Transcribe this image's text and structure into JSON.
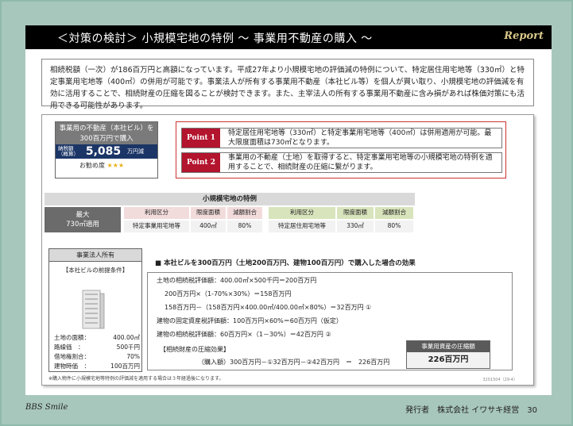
{
  "header": {
    "title": "＜対策の検討＞ 小規模宅地の特例 〜 事業用不動産の購入 〜",
    "badge": "Report"
  },
  "intro": "相続税額（一次）が186百万円と高額になっています。平成27年より小規模宅地の評価減の特例について、特定居住用宅地等（330㎡）と特定事業用宅地等（400㎡）の併用が可能です。事業法人が所有する事業用不動産（本社ビル等）を個人が買い取り、小規模宅地の評価減を有効に活用することで、相続財産の圧縮を図ることが検討できます。また、主宰法人の所有する事業用不動産に含み損があれば株価対策にも活用できる可能性があります。",
  "case": {
    "title": "事業用の不動産（本社ビル）を300百万円で購入",
    "amount_label": "納税額（概算）",
    "amount": "5,085",
    "unit": "万円減",
    "recommend_label": "お勧め度",
    "stars": "★★★"
  },
  "points": [
    {
      "tag": "Point 1",
      "text": "特定居住用宅地等（330㎡）と特定事業用宅地等（400㎡）は併用適用が可能。最大限度面積は730㎡となります。"
    },
    {
      "tag": "Point 2",
      "text": "事業用の不動産（土地）を取得すると、特定事業用宅地等の小規模宅地の特例を適用することで、相続財産の圧縮に繋がります。"
    }
  ],
  "table": {
    "caption": "小規模宅地の特例",
    "max_label": "最大",
    "max_value": "730㎡適用",
    "headers": [
      "利用区分",
      "限度面積",
      "減額割合",
      "利用区分",
      "限度面積",
      "減額割合"
    ],
    "row": [
      "特定事業用宅地等",
      "400㎡",
      "80%",
      "特定居住用宅地等",
      "330㎡",
      "80%"
    ]
  },
  "company": {
    "title": "事業法人所有",
    "condition": "【本社ビルの前提条件】",
    "facts": [
      {
        "k": "土地の面積：",
        "v": "400.00㎡"
      },
      {
        "k": "路線価　：",
        "v": "500千円"
      },
      {
        "k": "借地権割合：",
        "v": "70%"
      },
      {
        "k": "建物時価　：",
        "v": "100百万円"
      }
    ]
  },
  "calc": {
    "heading": "■ 本社ビルを300百万円（土地200百万円、建物100百万円）で購入した場合の効果",
    "lines": [
      "土地の相続税評価額：400.00㎡×500千円＝200百万円",
      "200百万円×（1-70%×30%）＝158百万円",
      "158百万円－（158百万円×400.00㎡/400.00㎡×80%）＝32百万円 ①",
      "建物の固定資産税評価額：100百万円×60%＝60百万円（仮定）",
      "建物の相続税評価額：60百万円×（1－30%）＝42百万円 ②",
      "【相続財産の圧縮効果】",
      "（購入額）300百万円－①32百万円－②42百万円　＝　226百万円"
    ],
    "result_label": "事業用資産の圧縮額",
    "result_value": "226百万円"
  },
  "footnote": "※購入物件に小規模宅地等特例の評価減を適用する場合は３年経過後になります。",
  "code": "3201504（29-4）",
  "footer": {
    "brand": "BBS Smile",
    "publisher": "発行者　株式会社 イワサキ経営　30"
  }
}
